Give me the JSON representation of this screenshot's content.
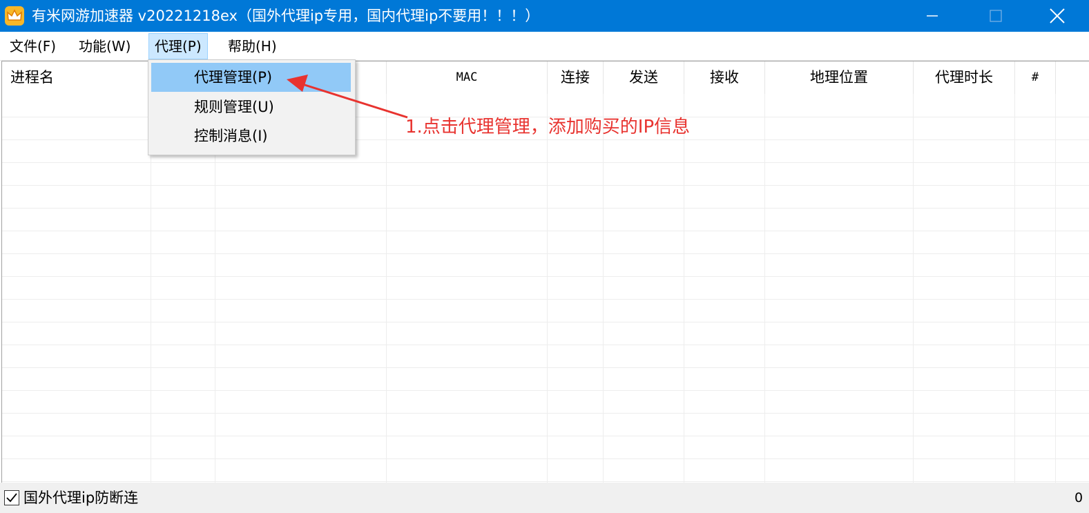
{
  "window": {
    "title": "有米网游加速器 v20221218ex（国外代理ip专用，国内代理ip不要用！！！）",
    "icon": "crown-icon",
    "accent": "#0078d7"
  },
  "menubar": {
    "items": [
      {
        "label": "文件(F)"
      },
      {
        "label": "功能(W)"
      },
      {
        "label": "代理(P)"
      },
      {
        "label": "帮助(H)"
      }
    ]
  },
  "table": {
    "columns": [
      "进程名",
      "",
      "",
      "MAC",
      "连接",
      "发送",
      "接收",
      "地理位置",
      "代理时长",
      "#"
    ]
  },
  "dropdown": {
    "items": [
      {
        "label": "代理管理(P)"
      },
      {
        "label": "规则管理(U)"
      },
      {
        "label": "控制消息(I)"
      }
    ]
  },
  "annotation": {
    "text": "1.点击代理管理，添加购买的IP信息",
    "color": "#e8332f"
  },
  "statusbar": {
    "checkbox_label": "国外代理ip防断连",
    "checked": true,
    "count": "0"
  }
}
